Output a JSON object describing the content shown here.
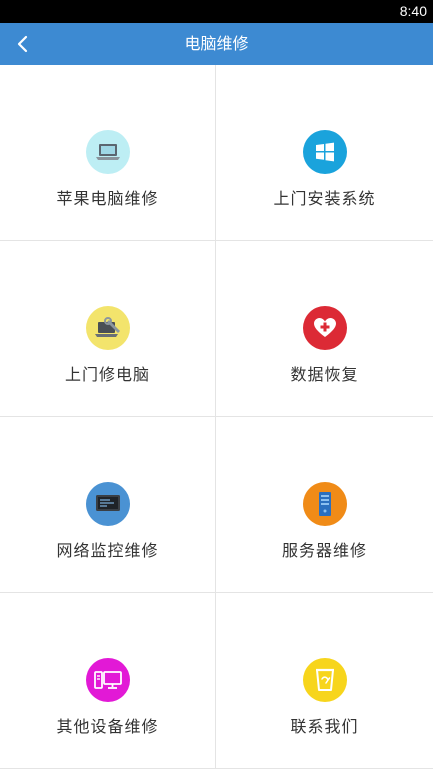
{
  "status_bar": {
    "time": "8:40"
  },
  "header": {
    "title": "电脑维修",
    "back_icon": "chevron-left-icon"
  },
  "colors": {
    "header_bg": "#3d8ad2",
    "apple_repair": "#bdeef4",
    "install_system": "#1aa3dc",
    "onsite_repair": "#f3e46c",
    "data_recovery": "#dc2a35",
    "network_monitoring": "#4a92d3",
    "server_repair": "#f08b17",
    "other_devices": "#e219d6",
    "contact_us": "#f7d51c"
  },
  "tiles": [
    {
      "label": "苹果电脑维修",
      "icon": "laptop-icon"
    },
    {
      "label": "上门安装系统",
      "icon": "windows-logo-icon"
    },
    {
      "label": "上门修电脑",
      "icon": "laptop-wrench-icon"
    },
    {
      "label": "数据恢复",
      "icon": "heart-plus-icon"
    },
    {
      "label": "网络监控维修",
      "icon": "monitor-icon"
    },
    {
      "label": "服务器维修",
      "icon": "server-icon"
    },
    {
      "label": "其他设备维修",
      "icon": "desktop-computer-icon"
    },
    {
      "label": "联系我们",
      "icon": "cup-icon"
    }
  ]
}
